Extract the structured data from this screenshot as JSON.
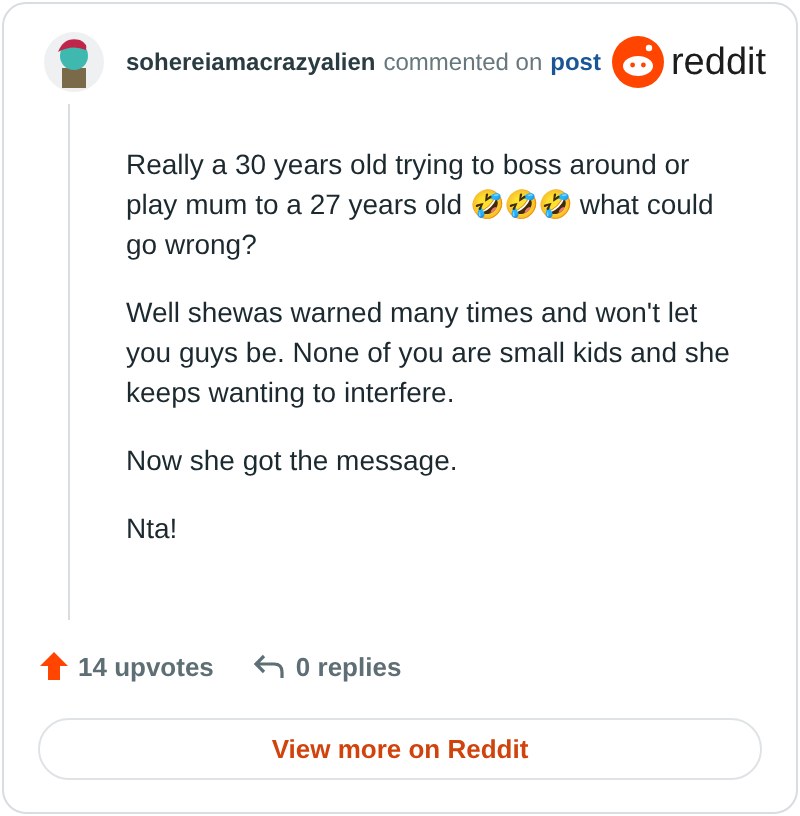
{
  "comment": {
    "author": "sohereiamacrazyalien",
    "action": "commented on",
    "link": "post",
    "brand": "reddit",
    "paragraphs": [
      "Really a 30 years old trying to boss around or play mum to a 27 years old 🤣🤣🤣 what could go wrong?",
      "Well shewas warned many times and won't let you guys be. None of you are small kids and she keeps wanting to interfere.",
      "Now she got the message.",
      "Nta!"
    ],
    "upvotes": "14 upvotes",
    "replies": "0 replies"
  },
  "button": "View more on Reddit"
}
